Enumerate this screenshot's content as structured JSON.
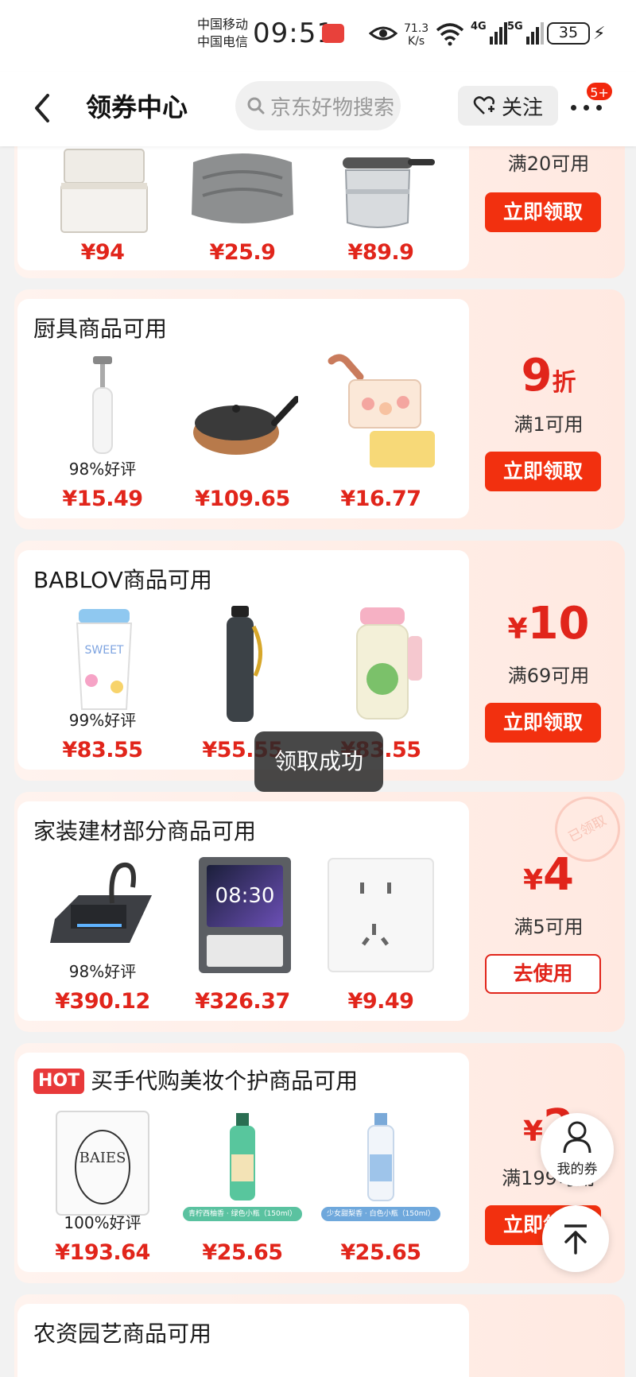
{
  "status_bar": {
    "carrier1": "中国移动",
    "carrier2": "中国电信",
    "time": "09:51",
    "net_speed_value": "71.3",
    "net_speed_unit": "K/s",
    "signal1_tag": "4G",
    "signal2_tag": "5G",
    "battery": "35"
  },
  "header": {
    "title": "领券中心",
    "search_placeholder": "京东好物搜索",
    "follow_label": "关注",
    "more_badge": "5+"
  },
  "cards": [
    {
      "title": "",
      "coupon_value": "",
      "condition": "满20可用",
      "button": "立即领取",
      "products": [
        {
          "name": "storage-box",
          "review": "",
          "price": "¥94"
        },
        {
          "name": "blanket",
          "review": "",
          "price": "¥25.9"
        },
        {
          "name": "pressure-cooker",
          "review": "",
          "price": "¥89.9"
        }
      ]
    },
    {
      "title": "厨具商品可用",
      "coupon_value": "9",
      "coupon_unit": "折",
      "condition": "满1可用",
      "button": "立即领取",
      "products": [
        {
          "name": "milk-frother",
          "review": "98%好评",
          "price": "¥15.49"
        },
        {
          "name": "frying-pan",
          "review": "",
          "price": "¥109.65"
        },
        {
          "name": "ice-tray",
          "review": "",
          "price": "¥16.77"
        }
      ]
    },
    {
      "title": "BABLOV商品可用",
      "coupon_symbol": "¥",
      "coupon_value": "10",
      "condition": "满69可用",
      "button": "立即领取",
      "products": [
        {
          "name": "cup",
          "review": "99%好评",
          "price": "¥83.55"
        },
        {
          "name": "water-bottle",
          "review": "",
          "price": "¥55.55"
        },
        {
          "name": "kids-bottle",
          "review": "",
          "price": "¥83.55"
        }
      ]
    },
    {
      "title": "家装建材部分商品可用",
      "coupon_symbol": "¥",
      "coupon_value": "4",
      "condition": "满5可用",
      "button": "去使用",
      "stamp": "已领取",
      "products": [
        {
          "name": "kitchen-sink",
          "review": "98%好评",
          "price": "¥390.12"
        },
        {
          "name": "smart-switch",
          "review": "",
          "price": "¥326.37",
          "screen_time": "08:30"
        },
        {
          "name": "wall-socket",
          "review": "",
          "price": "¥9.49"
        }
      ]
    },
    {
      "hot": "HOT",
      "title": "买手代购美妆个护商品可用",
      "coupon_symbol": "¥",
      "coupon_value": "2",
      "condition": "满199可用",
      "button": "立即领取",
      "products": [
        {
          "name": "candle",
          "review": "100%好评",
          "price": "¥193.64"
        },
        {
          "name": "spray-green",
          "review": "",
          "price": "¥25.65",
          "caption": "青柠西柚香 · 绿色小瓶（150ml）"
        },
        {
          "name": "spray-blue",
          "review": "",
          "price": "¥25.65",
          "caption": "少女甜梨香 · 白色小瓶（150ml）"
        }
      ]
    },
    {
      "title": "农资园艺商品可用"
    }
  ],
  "toast": "领取成功",
  "fab": {
    "my_coupon": "我的券"
  }
}
